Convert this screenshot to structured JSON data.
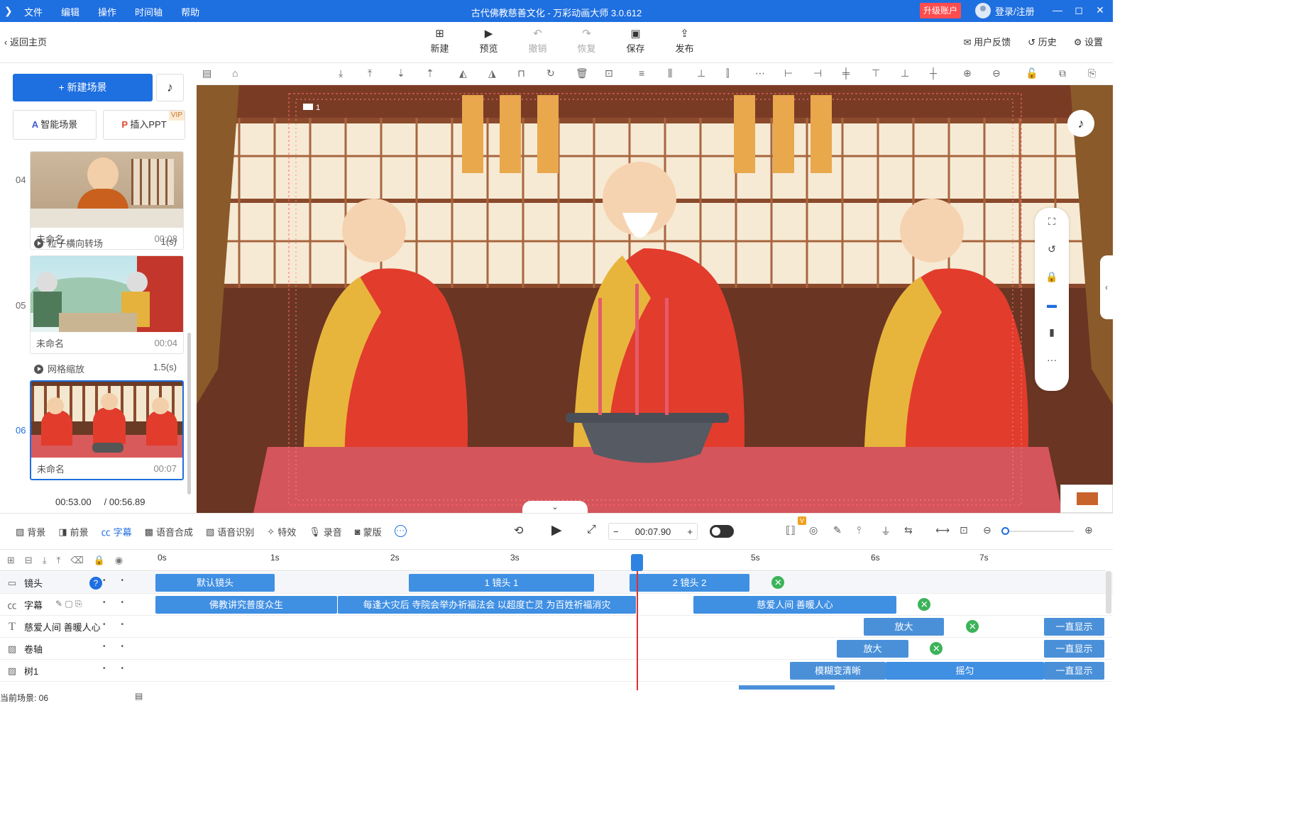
{
  "titlebar": {
    "menu": [
      "文件",
      "编辑",
      "操作",
      "时间轴",
      "帮助"
    ],
    "title": "古代佛教慈善文化 - 万彩动画大师 3.0.612",
    "upgrade": "升级账户",
    "login": "登录/注册"
  },
  "toolbar": {
    "back": "返回主页",
    "tools": [
      {
        "icon": "plus-square-icon",
        "label": "新建"
      },
      {
        "icon": "play-icon",
        "label": "预览"
      },
      {
        "icon": "undo-icon",
        "label": "撤销",
        "disabled": true
      },
      {
        "icon": "redo-icon",
        "label": "恢复",
        "disabled": true
      },
      {
        "icon": "save-icon",
        "label": "保存"
      },
      {
        "icon": "publish-icon",
        "label": "发布"
      }
    ],
    "right": [
      "用户反馈",
      "历史",
      "设置"
    ]
  },
  "left": {
    "new_scene": "新建场景",
    "smart": "智能场景",
    "ppt": "插入PPT",
    "vip": "VIP",
    "scenes": [
      {
        "num": "04",
        "name": "未命名",
        "dur": "00:08"
      },
      {
        "num": "05",
        "name": "未命名",
        "dur": "00:04"
      },
      {
        "num": "06",
        "name": "未命名",
        "dur": "00:07"
      }
    ],
    "transitions": [
      {
        "name": "粒子横向转场",
        "dur": "1(s)"
      },
      {
        "name": "网格缩放",
        "dur": "1.5(s)"
      }
    ],
    "time_current": "00:53.00",
    "time_total": "/ 00:56.89"
  },
  "stage": {
    "camera_label": "1"
  },
  "timeline_bar": {
    "tabs": [
      "背景",
      "前景",
      "字幕",
      "语音合成",
      "语音识别",
      "特效",
      "录音",
      "蒙版"
    ],
    "active_tab": "字幕",
    "time": "00:07.90",
    "v_badge": "V"
  },
  "ruler": [
    "0s",
    "1s",
    "2s",
    "3s",
    "5s",
    "6s",
    "7s"
  ],
  "tracks": [
    {
      "name": "镜头",
      "clips": [
        "默认镜头",
        "1 镜头 1",
        "2 镜头 2"
      ]
    },
    {
      "name": "字幕",
      "clips": [
        "佛教讲究普度众生",
        "每逢大灾后 寺院会举办祈福法会 以超度亡灵 为百姓祈福消灾",
        "慈爱人间  善暖人心"
      ]
    },
    {
      "name": "慈爱人间 善暖人心",
      "clips": [
        "放大",
        "一直显示"
      ]
    },
    {
      "name": "卷轴",
      "clips": [
        "放大",
        "一直显示"
      ]
    },
    {
      "name": "树1",
      "clips": [
        "模糊变清晰",
        "摇匀",
        "一直显示"
      ]
    }
  ],
  "current_scene": "当前场景: 06"
}
